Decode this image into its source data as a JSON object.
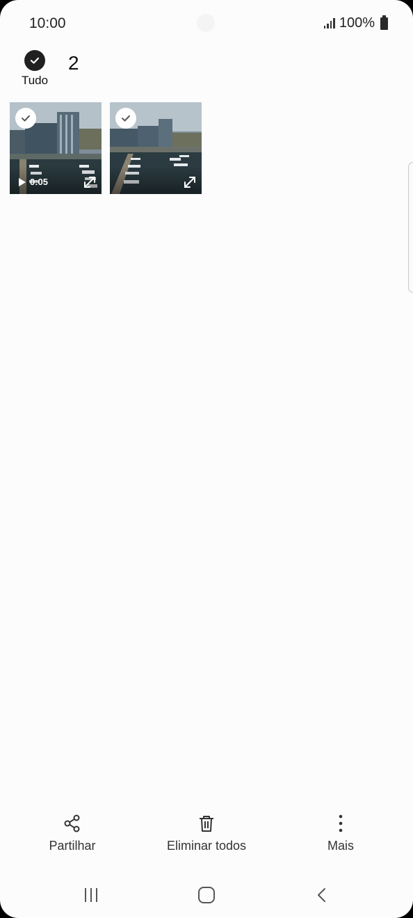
{
  "status_bar": {
    "time": "10:00",
    "battery_text": "100%",
    "icons": [
      "signal-icon",
      "battery-icon"
    ]
  },
  "selection": {
    "select_all_label": "Tudo",
    "selected_count": "2"
  },
  "thumbnails": [
    {
      "type": "video",
      "duration": "0:05",
      "selected": true,
      "icon": "play-icon"
    },
    {
      "type": "video",
      "duration": "",
      "selected": true,
      "icon": "expand-icon"
    }
  ],
  "actions": {
    "share_label": "Partilhar",
    "delete_label": "Eliminar todos",
    "more_label": "Mais"
  },
  "nav": {
    "icons": [
      "recent-apps-icon",
      "home-icon",
      "back-icon"
    ]
  },
  "colors": {
    "background": "#fcfcfc",
    "check_dark": "#202020",
    "text": "#333333"
  }
}
